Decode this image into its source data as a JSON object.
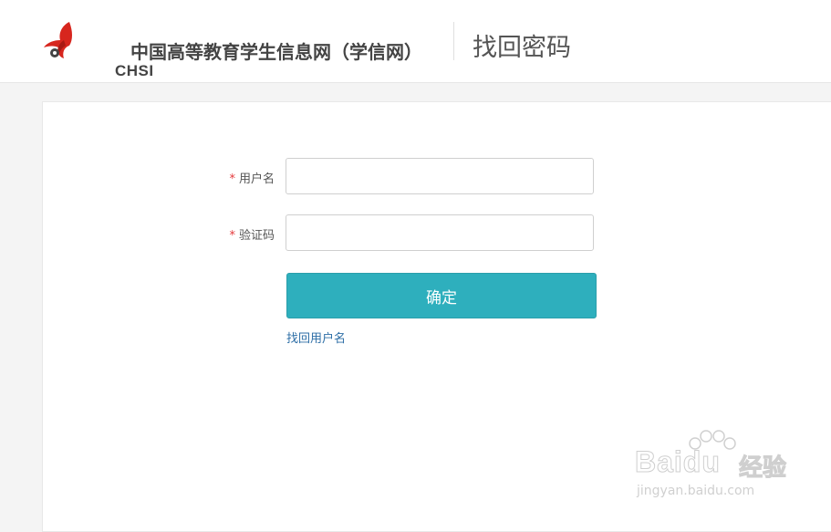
{
  "header": {
    "logo_text": "CHSI",
    "site_name": "中国高等教育学生信息网（学信网）",
    "page_title": "找回密码"
  },
  "form": {
    "username": {
      "required_mark": "*",
      "label": "用户名",
      "value": ""
    },
    "captcha": {
      "required_mark": "*",
      "label": "验证码",
      "value": ""
    },
    "submit_label": "确定",
    "recover_username_link": "找回用户名"
  },
  "watermark": {
    "brand": "Baidu",
    "cn": "经验",
    "url": "jingyan.baidu.com"
  },
  "colors": {
    "button": "#2eafbd",
    "link": "#2d6ea6",
    "required": "#e4393c",
    "logo_red": "#d7261e"
  }
}
